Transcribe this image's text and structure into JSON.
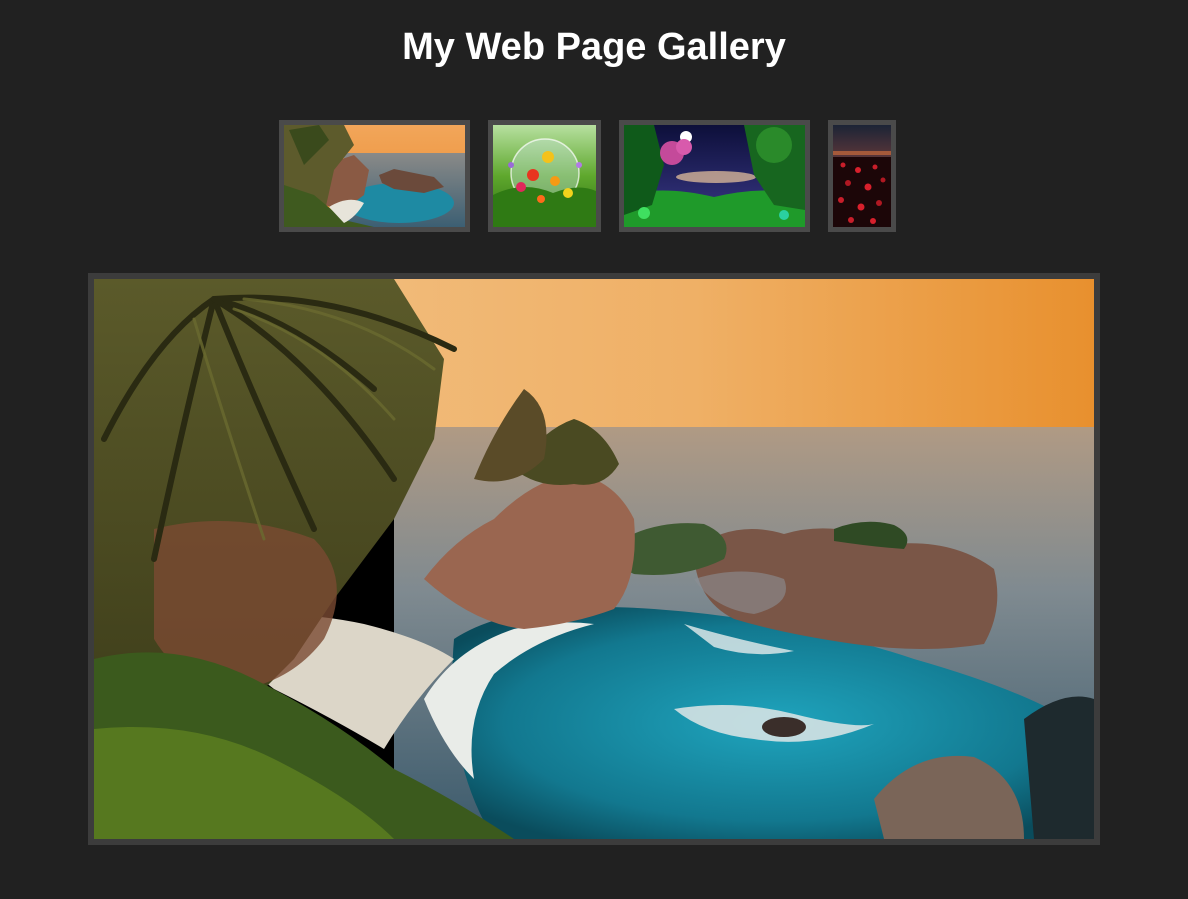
{
  "page": {
    "title": "My Web Page Gallery",
    "background": "#212121"
  },
  "thumbnails": [
    {
      "subject": "coastal cove with palm trees at sunset",
      "selected": true
    },
    {
      "subject": "colorful flowers in a glass bubble"
    },
    {
      "subject": "fantasy night forest with full moon"
    },
    {
      "subject": "red poppy field at dusk"
    }
  ],
  "featured": {
    "subject": "coastal cove with palm trees at sunset"
  },
  "colors": {
    "thumbnail_border": "#4a4a4a",
    "featured_border": "#3c3c3c",
    "title_text": "#ffffff"
  }
}
